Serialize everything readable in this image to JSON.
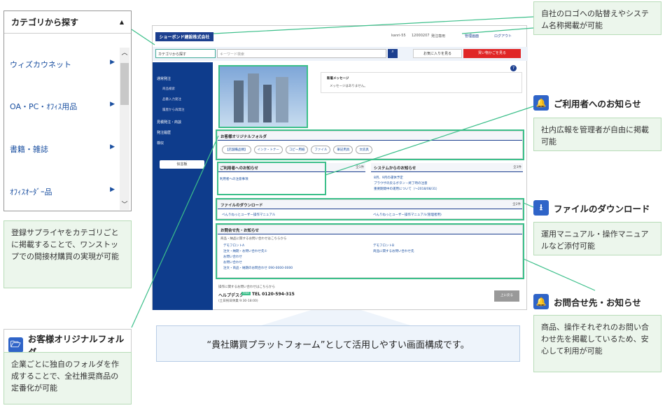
{
  "category_panel": {
    "title": "カテゴリから探す",
    "items": [
      {
        "label": "ウィズカウネット"
      },
      {
        "label": "OA・PC・ｵﾌｨｽ用品"
      },
      {
        "label": "書籍・雑誌"
      },
      {
        "label": "ｵﾌｨｽｵｰﾀﾞｰ品"
      }
    ]
  },
  "notes": {
    "category_note": "登録サプライヤをカテゴリごとに掲載することで、ワンストップでの間接材購買の実現が可能",
    "logo_note": "自社のロゴへの貼替えやシステム名称掲載が可能",
    "user_notice_title": "ご利用者へのお知らせ",
    "user_notice_note": "社内広報を管理者が自由に掲載可能",
    "file_dl_title": "ファイルのダウンロード",
    "file_dl_note": "運用マニュアル・操作マニュアルなど添付可能",
    "contact_title": "お問合せ先・お知らせ",
    "contact_note": "商品、操作それぞれのお問い合わせ先を掲載しているため、安心して利用が可能",
    "folder_title": "お客様オリジナルフォルダ",
    "folder_note": "企業ごとに独自のフォルダを作成することで、全社推奨商品の定番化が可能",
    "banner": "“貴社購買プラットフォーム”として活用しやすい画面構成です。"
  },
  "shot": {
    "logo": "ショーボンド建設株式会社",
    "user": "kanri-55",
    "code": "12000207",
    "dept": "発注専用",
    "manage": "管理画面",
    "logout": "ログアウト",
    "category_select": "カテゴリから探す",
    "search_placeholder": "キーワード検索",
    "fav_btn": "お気に入りを見る",
    "history_btn": "買い物かごを見る",
    "side_items": [
      "通常発注",
      "見積発注・商談",
      "発注履歴",
      "検収"
    ],
    "side_subs": [
      "商品検索",
      "品番入力発注",
      "履歴から再発注"
    ],
    "pc_btn": "伝言板",
    "message_title": "新着メッセージ",
    "message_body": "メッセージはありません。",
    "folder_title": "お客様オリジナルフォルダ",
    "folder_buttons": [
      "【店舗備品類】",
      "インク・トナー",
      "コピー用紙",
      "ファイル",
      "筆記用具",
      "文房具"
    ],
    "user_notice_title": "ご利用者へのお知らせ",
    "user_notice_link": "利用者への注意事項",
    "user_notice_all": "全1件",
    "system_notice_title": "システムからのお知らせ",
    "system_notice_all": "全3件",
    "system_links": [
      "8月、9月の運休予定",
      "ブラウザの戻るボタン・終了時の注意",
      "重要期間中の運用について（〜2018/08/31）"
    ],
    "file_title": "ファイルのダウンロード",
    "file_all": "全2件",
    "file_links": [
      "べんりねっとユーザー操作マニュアル",
      "べんりねっとユーザー操作マニュアル(管理者用)"
    ],
    "contact_title": "お問合せ先・お知らせ",
    "contact_intro": "商品・納品に関するお問い合わせはこちらから",
    "contact_left": [
      "デモフロントA",
      "注文・納期・お問い合わせ先①",
      "お問い合わせ",
      "お問い合わせ",
      "注文・商品・納期のお問合わせ 090-0000-0000"
    ],
    "contact_right": [
      "デモフロントB",
      "商品に関するお問い合わせ先"
    ],
    "help_intro": "操作に関するお問い合わせはこちらから",
    "help_desk": "ヘルプデスク",
    "free_dial": "free",
    "tel": "TEL 0120-594-315",
    "hours": "(土日祝日休業 9:30-18:00)",
    "page_top": "上に戻る"
  }
}
